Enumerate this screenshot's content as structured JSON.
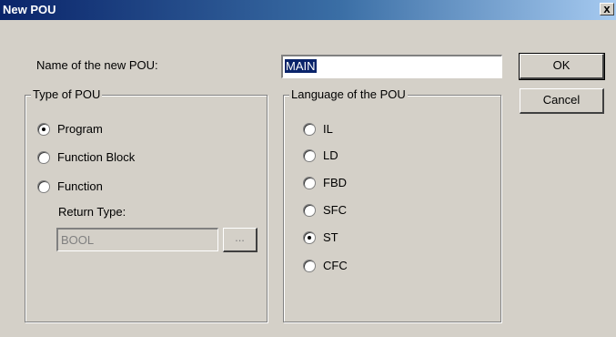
{
  "window": {
    "title": "New POU",
    "close_glyph": "x"
  },
  "form": {
    "name_label": "Name of the new POU:",
    "name_value": "MAIN"
  },
  "buttons": {
    "ok": "OK",
    "cancel": "Cancel"
  },
  "type_group": {
    "legend": "Type of POU",
    "options": [
      {
        "label": "Program",
        "checked": true
      },
      {
        "label": "Function Block",
        "checked": false
      },
      {
        "label": "Function",
        "checked": false
      }
    ],
    "return_type_label": "Return Type:",
    "return_type_value": "BOOL",
    "browse_label": "..."
  },
  "language_group": {
    "legend": "Language of the POU",
    "options": [
      {
        "label": "IL",
        "checked": false
      },
      {
        "label": "LD",
        "checked": false
      },
      {
        "label": "FBD",
        "checked": false
      },
      {
        "label": "SFC",
        "checked": false
      },
      {
        "label": "ST",
        "checked": true
      },
      {
        "label": "CFC",
        "checked": false
      }
    ]
  }
}
